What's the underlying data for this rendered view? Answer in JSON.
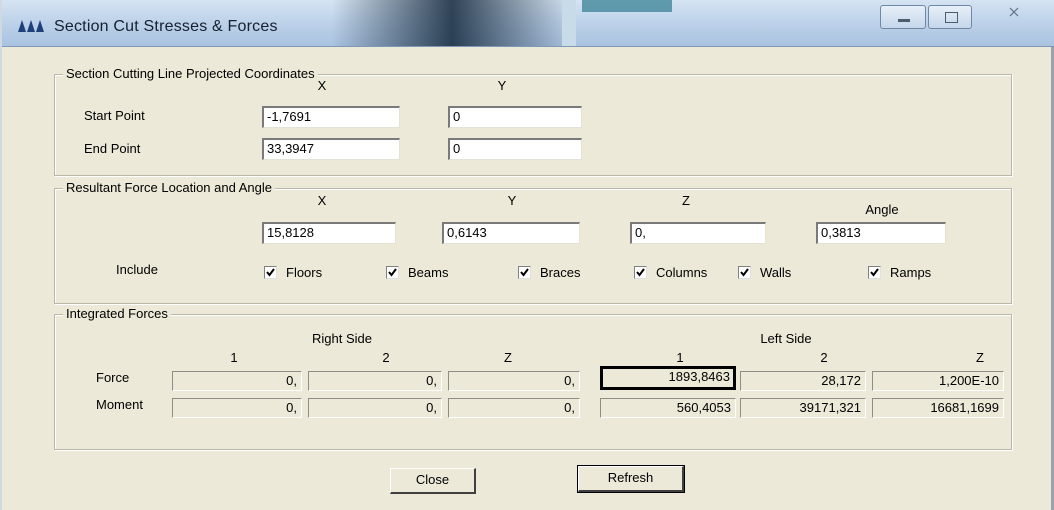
{
  "window": {
    "title": "Section Cut Stresses & Forces"
  },
  "coords": {
    "legend": "Section Cutting Line Projected Coordinates",
    "col_x": "X",
    "col_y": "Y",
    "start_label": "Start Point",
    "start_x": "-1,7691",
    "start_y": "0",
    "end_label": "End Point",
    "end_x": "33,3947",
    "end_y": "0"
  },
  "resultant": {
    "legend": "Resultant Force Location and Angle",
    "col_x": "X",
    "col_y": "Y",
    "col_z": "Z",
    "col_angle": "Angle",
    "x": "15,8128",
    "y": "0,6143",
    "z": "0,",
    "angle": "0,3813",
    "include_label": "Include",
    "checks": [
      {
        "label": "Floors",
        "checked": true
      },
      {
        "label": "Beams",
        "checked": true
      },
      {
        "label": "Braces",
        "checked": true
      },
      {
        "label": "Columns",
        "checked": true
      },
      {
        "label": "Walls",
        "checked": true
      },
      {
        "label": "Ramps",
        "checked": true
      }
    ]
  },
  "integrated": {
    "legend": "Integrated Forces",
    "right_side": "Right Side",
    "left_side": "Left Side",
    "cols": [
      "1",
      "2",
      "Z",
      "1",
      "2",
      "Z"
    ],
    "force_label": "Force",
    "moment_label": "Moment",
    "force": [
      "0,",
      "0,",
      "0,",
      "1893,8463",
      "28,172",
      "1,200E-10"
    ],
    "moment": [
      "0,",
      "0,",
      "0,",
      "560,4053",
      "39171,321",
      "16681,1699"
    ]
  },
  "buttons": {
    "close": "Close",
    "refresh": "Refresh"
  }
}
